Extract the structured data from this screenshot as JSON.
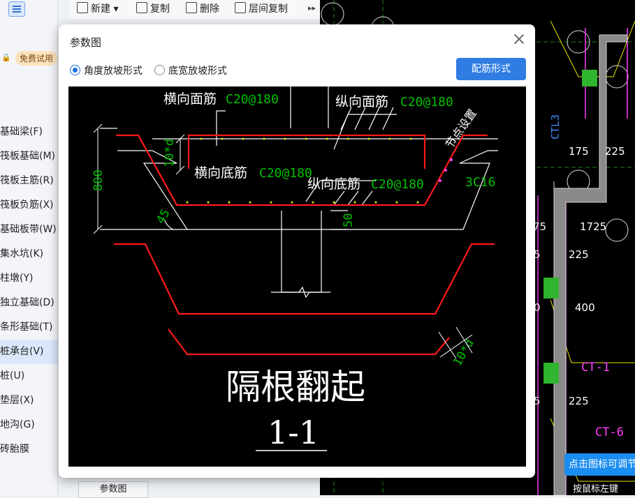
{
  "sidebar": {
    "trial_badge": "免费试用",
    "items": [
      "基础梁(F)",
      "筏板基础(M)",
      "筏板主筋(R)",
      "筏板负筋(X)",
      "基础板带(W)",
      "集水坑(K)",
      "柱墩(Y)",
      "独立基础(D)",
      "条形基础(T)",
      "桩承台(V)",
      "桩(U)",
      "垫层(X)",
      "地沟(G)",
      "砖胎膜"
    ],
    "active_index": 9
  },
  "toolbar": {
    "new_label": "新建",
    "copy_label": "复制",
    "delete_label": "删除",
    "floor_copy_label": "层间复制"
  },
  "bottom_tab": "参数图",
  "dialog": {
    "title": "参数图",
    "radio_angle": "角度放坡形式",
    "radio_width": "底宽放坡形式",
    "selected": "angle",
    "rebar_button": "配筋形式"
  },
  "drawing": {
    "top_label_cn": "横向面筋",
    "top_label_val": "C20@180",
    "long_top_cn": "纵向面筋",
    "long_top_val": "C20@180",
    "bot_label_cn": "横向底筋",
    "bot_label_val": "C20@180",
    "long_bot_cn": "纵向底筋",
    "long_bot_val": "C20@180",
    "node_setting": "节点设置",
    "side_bars": "3C16",
    "dim_800": "800",
    "dim_10d": "10*d",
    "dim_45": "45",
    "dim_50": "50",
    "dim_10d_2": "10*d",
    "caption": "隔根翻起",
    "section": "1-1"
  },
  "cad": {
    "labels": [
      "CTL3",
      "175",
      "225",
      "75",
      "1725",
      "5",
      "225",
      "0",
      "400",
      "CT-1",
      "5",
      "225",
      "CT-6"
    ],
    "tooltip": "点击图标可调节",
    "status": "按鼠标左键"
  },
  "colors": {
    "accent": "#2f7ce3",
    "rebar": "#ff1a1a",
    "dim": "#00c000",
    "cad_line": "#ffffff"
  }
}
